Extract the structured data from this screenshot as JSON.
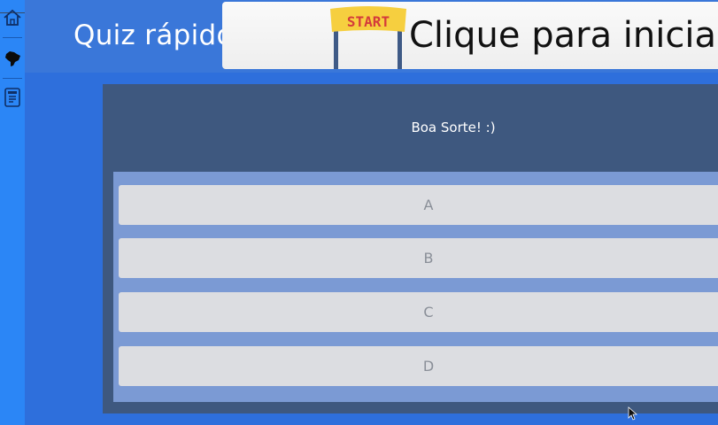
{
  "app": {
    "title": "Quiz rápido"
  },
  "banner": {
    "sign_text": "START",
    "start_prompt": "Clique para iniciar"
  },
  "quiz": {
    "question": "Boa Sorte! :)",
    "options": [
      "A",
      "B",
      "C",
      "D"
    ]
  },
  "sidebar": {
    "items": [
      {
        "icon": "home-icon"
      },
      {
        "icon": "brazil-map-icon"
      },
      {
        "icon": "document-icon"
      }
    ]
  },
  "colors": {
    "background": "#2e6fdc",
    "rail": "#2b86f6",
    "panel": "#3e587f",
    "answers_area": "#7b9ad4",
    "answer_button": "#dcdde1"
  }
}
